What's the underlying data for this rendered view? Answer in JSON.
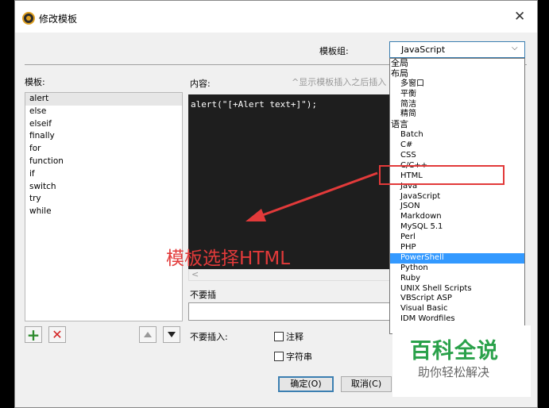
{
  "window": {
    "title": "修改模板",
    "close_glyph": "✕"
  },
  "group": {
    "label": "模板组:",
    "selected": "JavaScript",
    "chevron": "⌵"
  },
  "templates": {
    "label": "模板:",
    "items": [
      "alert",
      "else",
      "elseif",
      "finally",
      "for",
      "function",
      "if",
      "switch",
      "try",
      "while"
    ],
    "selected_index": 0
  },
  "content": {
    "label": "内容:",
    "hint": "^显示模板插入之后插入",
    "code": "alert(\"[+Alert text+]\");",
    "scroll_left": "<"
  },
  "no_insert": {
    "label": "不要插",
    "label2": "不要插入:",
    "comment_label": "注释",
    "string_label": "字符串"
  },
  "buttons": {
    "ok": "确定(O)",
    "cancel": "取消(C)",
    "add_glyph": "+",
    "delete_glyph": "✕"
  },
  "dropdown": {
    "items": [
      {
        "text": "全局",
        "kind": "hdr"
      },
      {
        "text": "布局",
        "kind": "hdr"
      },
      {
        "text": "多窗口",
        "kind": "ind"
      },
      {
        "text": "平衡",
        "kind": "ind"
      },
      {
        "text": "简洁",
        "kind": "ind"
      },
      {
        "text": "精简",
        "kind": "ind"
      },
      {
        "text": "语言",
        "kind": "hdr"
      },
      {
        "text": "Batch",
        "kind": "ind"
      },
      {
        "text": "C#",
        "kind": "ind"
      },
      {
        "text": "CSS",
        "kind": "ind"
      },
      {
        "text": "C/C++",
        "kind": "ind"
      },
      {
        "text": "HTML",
        "kind": "ind"
      },
      {
        "text": "Java",
        "kind": "ind"
      },
      {
        "text": "JavaScript",
        "kind": "ind"
      },
      {
        "text": "JSON",
        "kind": "ind"
      },
      {
        "text": "Markdown",
        "kind": "ind"
      },
      {
        "text": "MySQL 5.1",
        "kind": "ind"
      },
      {
        "text": "Perl",
        "kind": "ind"
      },
      {
        "text": "PHP",
        "kind": "ind"
      },
      {
        "text": "PowerShell",
        "kind": "ind"
      },
      {
        "text": "Python",
        "kind": "ind"
      },
      {
        "text": "Ruby",
        "kind": "ind"
      },
      {
        "text": "UNIX Shell Scripts",
        "kind": "ind"
      },
      {
        "text": "VBScript ASP",
        "kind": "ind"
      },
      {
        "text": "Visual Basic",
        "kind": "ind"
      },
      {
        "text": "IDM Wordfiles",
        "kind": "ind"
      }
    ],
    "selected_index": 19
  },
  "annotation": {
    "text": "模板选择HTML",
    "color": "#e23a3a"
  },
  "watermark": {
    "main": "百科全说",
    "sub": "助你轻松解决",
    "color": "#2aa14a"
  }
}
